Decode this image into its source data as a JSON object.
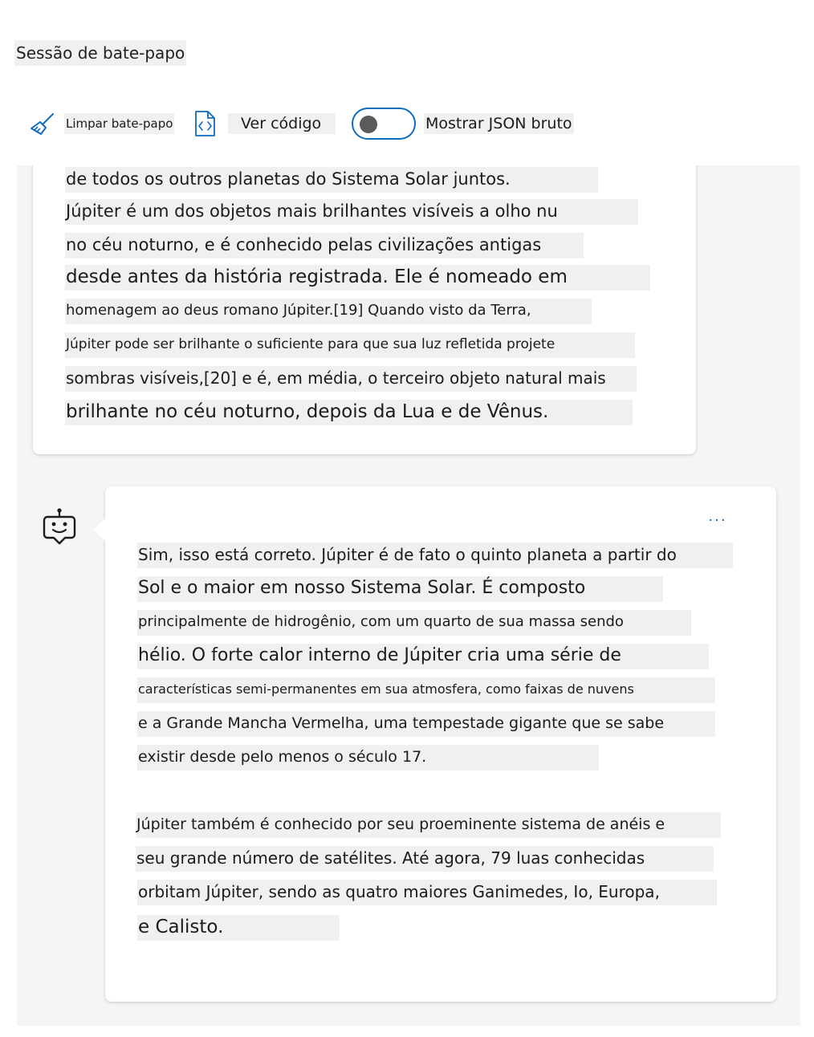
{
  "session": {
    "title": "Sessão de bate-papo"
  },
  "toolbar": {
    "clear_label": "Limpar bate-papo",
    "code_label": "Ver código",
    "json_label": "Mostrar JSON bruto",
    "json_toggle_on": false
  },
  "colors": {
    "accent": "#0f6cbd",
    "chat_background": "#f5f5f5",
    "text_highlight": "#f0f0f0"
  },
  "user_message": {
    "lines": [
      "de todos os outros planetas do Sistema Solar juntos.",
      "Júpiter é um dos objetos mais brilhantes visíveis a olho nu",
      "no céu noturno, e é conhecido pelas civilizações antigas",
      "desde antes da história registrada. Ele é nomeado em",
      "homenagem ao deus romano Júpiter.[19] Quando visto da Terra,",
      "Júpiter pode ser brilhante o suficiente para que sua luz refletida projete",
      "sombras visíveis,[20] e é, em média, o terceiro objeto natural mais",
      "brilhante no céu noturno, depois da Lua e de Vênus."
    ]
  },
  "bot_message": {
    "more_label": "...",
    "avatar_icon": "bot-icon",
    "paragraph1": [
      "Sim, isso está correto. Júpiter é de fato o quinto planeta a partir do",
      "Sol e o maior em nosso Sistema Solar. É composto",
      "principalmente de hidrogênio, com um quarto de sua massa sendo",
      "hélio. O forte calor interno de Júpiter cria uma série de",
      "características semi-permanentes em sua atmosfera, como faixas de nuvens",
      "e a Grande Mancha Vermelha, uma tempestade gigante que se sabe",
      "existir desde pelo menos o século 17."
    ],
    "paragraph2": [
      "Júpiter também é conhecido por seu proeminente sistema de anéis e",
      "seu grande número de satélites. Até agora, 79 luas conhecidas",
      "orbitam Júpiter, sendo as quatro maiores Ganimedes, Io, Europa,",
      "e Calisto."
    ]
  }
}
